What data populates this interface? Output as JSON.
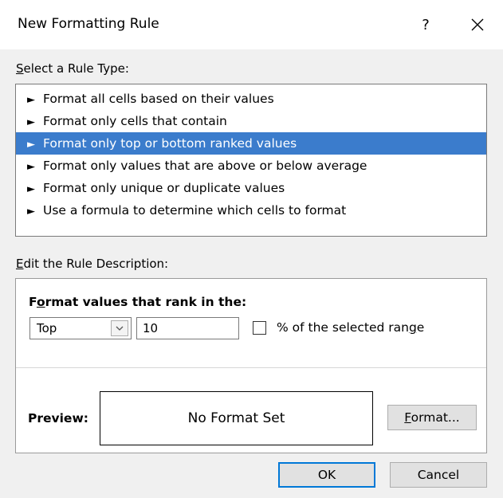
{
  "dialog": {
    "title": "New Formatting Rule",
    "help_label": "?"
  },
  "rule_type": {
    "label_accel": "S",
    "label_rest": "elect a Rule Type:",
    "items": [
      {
        "arrow": "►",
        "label": "Format all cells based on their values",
        "selected": false
      },
      {
        "arrow": "►",
        "label": "Format only cells that contain",
        "selected": false
      },
      {
        "arrow": "►",
        "label": "Format only top or bottom ranked values",
        "selected": true
      },
      {
        "arrow": "►",
        "label": "Format only values that are above or below average",
        "selected": false
      },
      {
        "arrow": "►",
        "label": "Format only unique or duplicate values",
        "selected": false
      },
      {
        "arrow": "►",
        "label": "Use a formula to determine which cells to format",
        "selected": false
      }
    ]
  },
  "description": {
    "label_accel": "E",
    "label_rest": "dit the Rule Description:",
    "heading_pre": "F",
    "heading_accel": "o",
    "heading_rest": "rmat values that rank in the:",
    "rank_select": "Top",
    "rank_value": "10",
    "percent_checked": false,
    "percent_label_pre": "% of the selected ran",
    "percent_label_accel": "g",
    "percent_label_rest": "e",
    "preview_label": "Preview:",
    "preview_text": "No Format Set",
    "format_btn_accel": "F",
    "format_btn_rest": "ormat..."
  },
  "footer": {
    "ok_label": "OK",
    "cancel_label": "Cancel"
  },
  "colors": {
    "selection": "#3b7ccc",
    "default_button_border": "#0078d7"
  }
}
